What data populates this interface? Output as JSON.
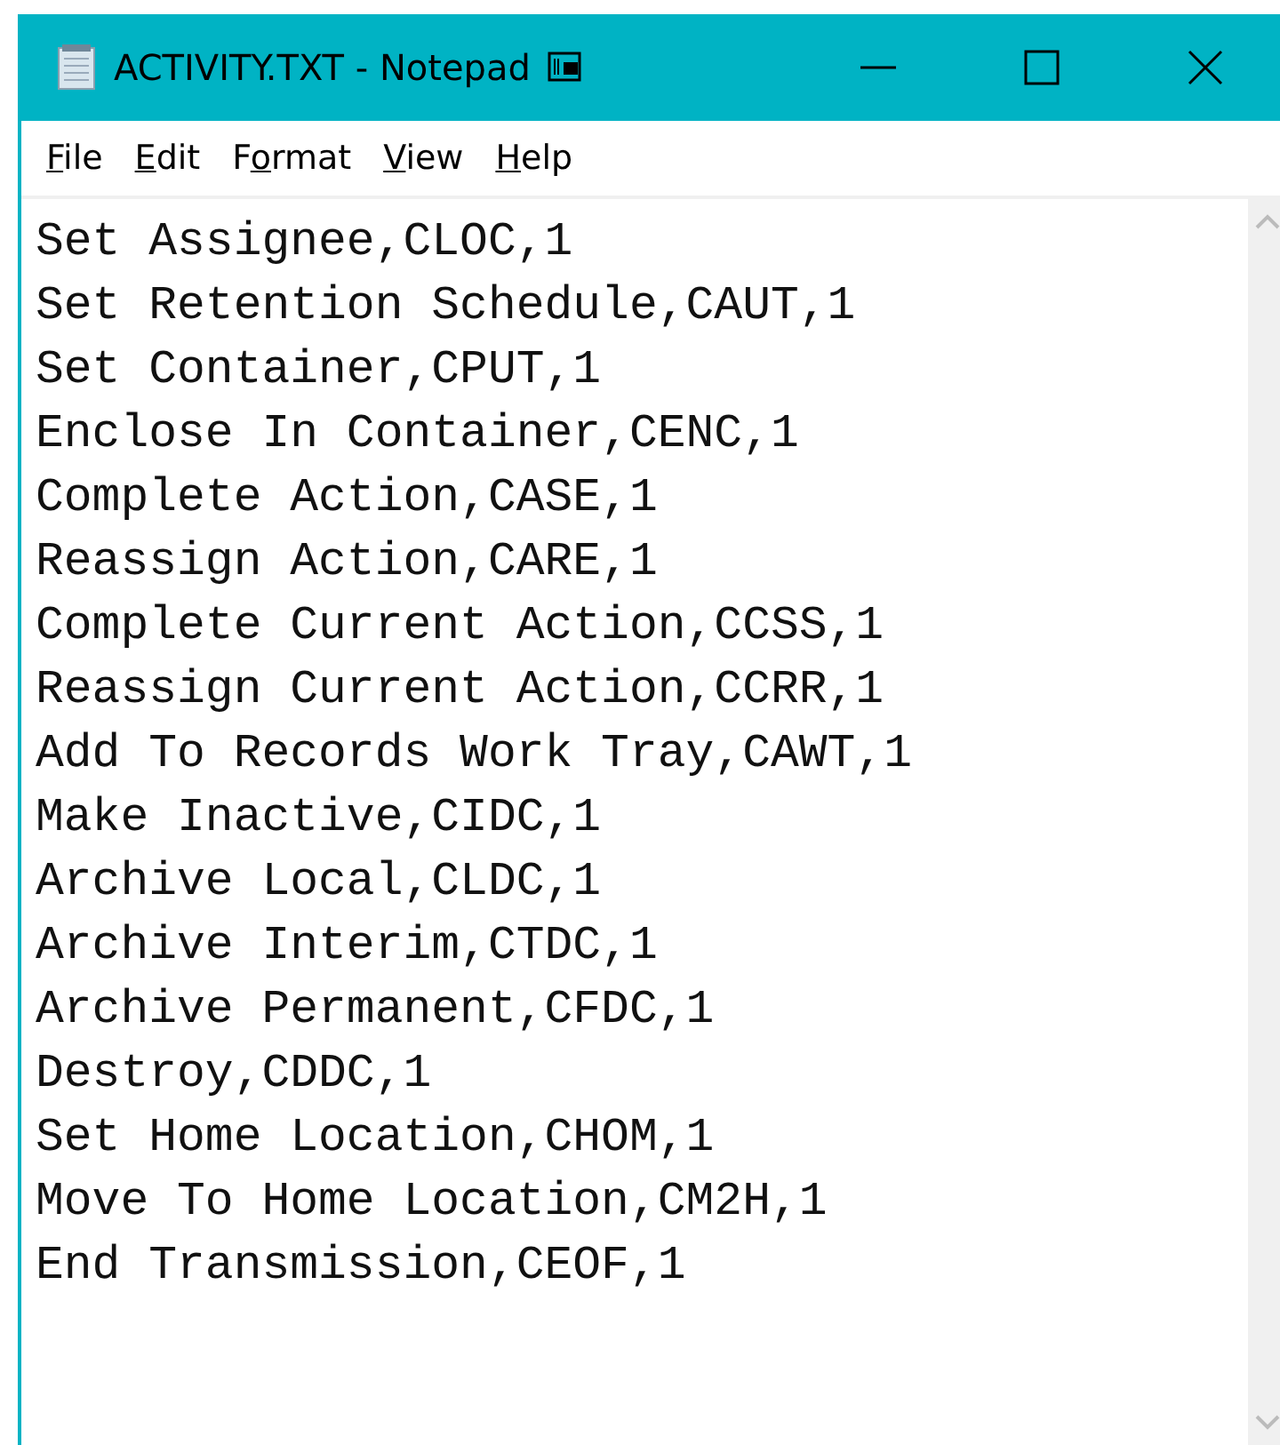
{
  "window": {
    "title": "ACTIVITY.TXT - Notepad"
  },
  "menu": [
    {
      "key": "F",
      "after": "ile"
    },
    {
      "key": "E",
      "after": "dit"
    },
    {
      "before": "F",
      "key": "o",
      "after": "rmat"
    },
    {
      "key": "V",
      "after": "iew"
    },
    {
      "key": "H",
      "after": "elp"
    }
  ],
  "lines": [
    "Set Assignee,CLOC,1",
    "Set Retention Schedule,CAUT,1",
    "Set Container,CPUT,1",
    "Enclose In Container,CENC,1",
    "Complete Action,CASE,1",
    "Reassign Action,CARE,1",
    "Complete Current Action,CCSS,1",
    "Reassign Current Action,CCRR,1",
    "Add To Records Work Tray,CAWT,1",
    "Make Inactive,CIDC,1",
    "Archive Local,CLDC,1",
    "Archive Interim,CTDC,1",
    "Archive Permanent,CFDC,1",
    "Destroy,CDDC,1",
    "Set Home Location,CHOM,1",
    "Move To Home Location,CM2H,1",
    "End Transmission,CEOF,1"
  ]
}
